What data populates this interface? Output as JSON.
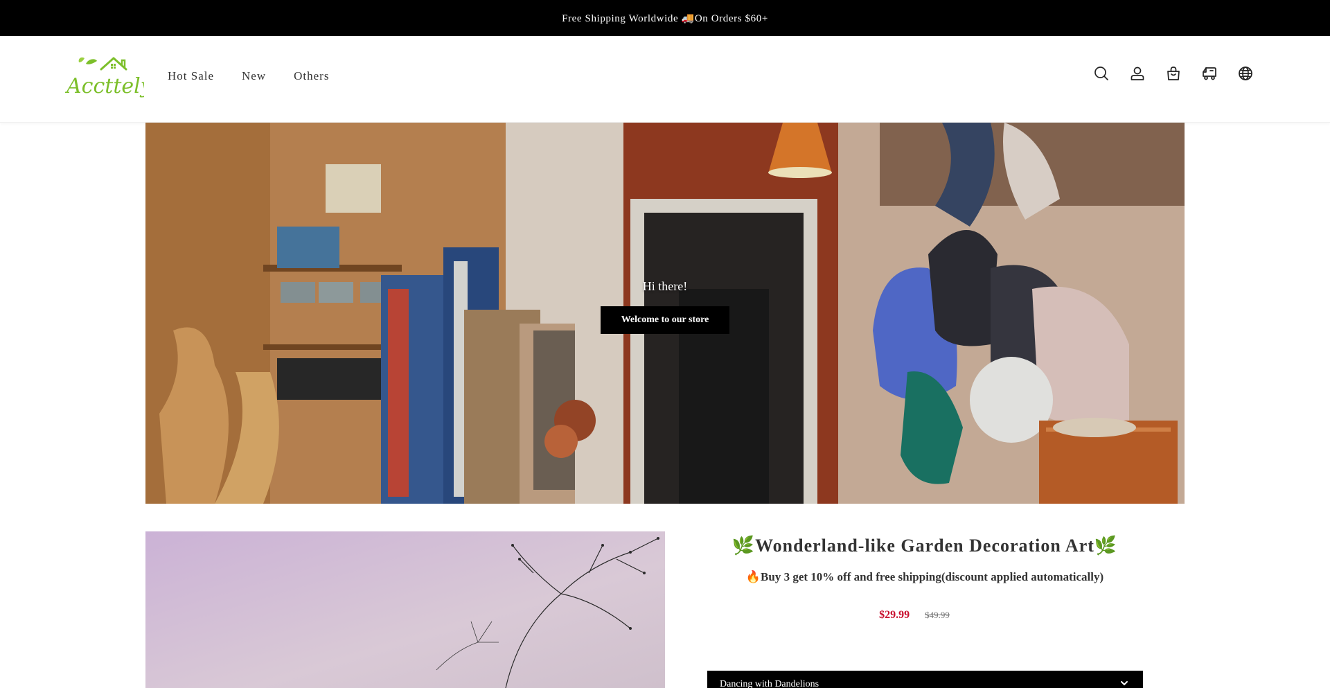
{
  "announcement": {
    "text": "Free Shipping Worldwide 🚚On Orders $60+"
  },
  "header": {
    "logo_text": "Accttely",
    "nav": [
      {
        "label": "Hot Sale"
      },
      {
        "label": "New"
      },
      {
        "label": "Others"
      }
    ],
    "icons": [
      "search-icon",
      "account-icon",
      "cart-icon",
      "truck-icon",
      "globe-icon"
    ]
  },
  "hero": {
    "greeting": "Hi there!",
    "button_label": "Welcome to our store"
  },
  "product": {
    "title": "🌿Wonderland-like Garden Decoration Art🌿",
    "subtitle": "🔥Buy 3 get 10% off and free shipping(discount applied automatically)",
    "price": "$29.99",
    "compare_price": "$49.99",
    "variant_selected": "Dancing with Dandelions"
  },
  "colors": {
    "announcement_bg": "#000000",
    "logo_green": "#7cbf2a",
    "sale_price": "#c8102e"
  }
}
